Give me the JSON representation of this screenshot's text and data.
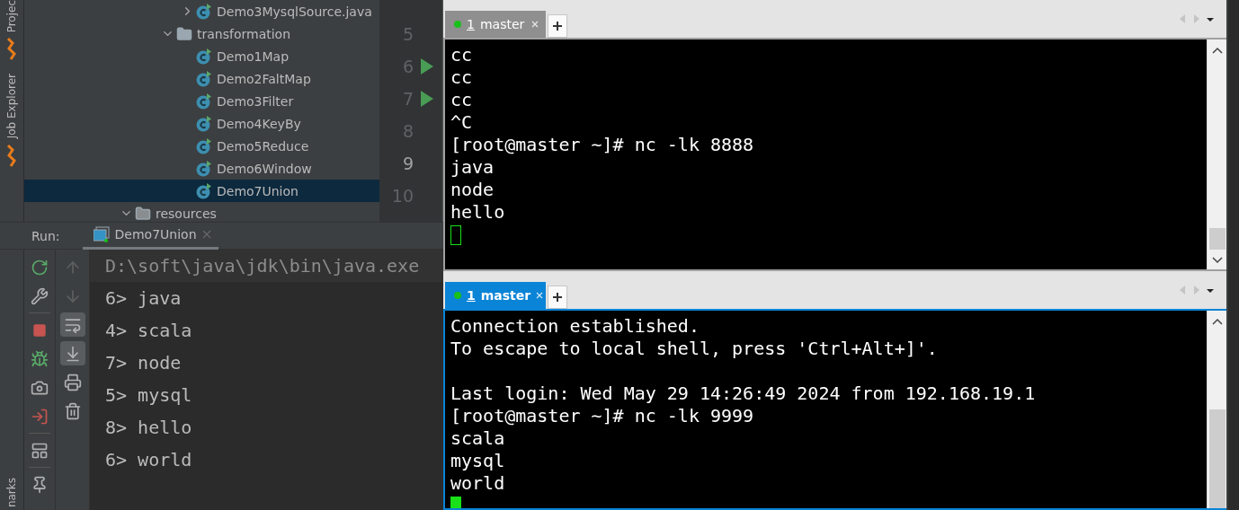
{
  "side_stripe": {
    "tabs": [
      {
        "label": "Projec",
        "kind": "top"
      },
      {
        "label": "Job Explorer",
        "kind": "top"
      },
      {
        "label": "narks",
        "kind": "bottom"
      }
    ]
  },
  "project_tree": {
    "items": [
      {
        "label": "Demo3MysqlSource.java",
        "kind": "class",
        "expanded": false,
        "selected": false
      },
      {
        "label": "transformation",
        "kind": "folder",
        "expanded": true,
        "selected": false,
        "children": [
          {
            "label": "Demo1Map",
            "kind": "class",
            "selected": false
          },
          {
            "label": "Demo2FaltMap",
            "kind": "class",
            "selected": false
          },
          {
            "label": "Demo3Filter",
            "kind": "class",
            "selected": false
          },
          {
            "label": "Demo4KeyBy",
            "kind": "class",
            "selected": false
          },
          {
            "label": "Demo5Reduce",
            "kind": "class",
            "selected": false
          },
          {
            "label": "Demo6Window",
            "kind": "class",
            "selected": false
          },
          {
            "label": "Demo7Union",
            "kind": "class",
            "selected": true
          }
        ]
      },
      {
        "label": "resources",
        "kind": "resources",
        "expanded": true,
        "selected": false
      }
    ]
  },
  "editor_gutter": {
    "lines": [
      {
        "number": "5",
        "runnable": false,
        "current": false
      },
      {
        "number": "6",
        "runnable": true,
        "current": false
      },
      {
        "number": "7",
        "runnable": true,
        "current": false
      },
      {
        "number": "8",
        "runnable": false,
        "current": false
      },
      {
        "number": "9",
        "runnable": false,
        "current": true
      },
      {
        "number": "10",
        "runnable": false,
        "current": false
      }
    ]
  },
  "run_panel": {
    "label": "Run:",
    "tab": {
      "label": "Demo7Union"
    },
    "toggles": [
      {
        "kind": "up",
        "on": false
      },
      {
        "kind": "down",
        "on": false
      },
      {
        "kind": "wrap",
        "on": true
      },
      {
        "kind": "scroll-end",
        "on": true
      },
      {
        "kind": "print",
        "on": false
      },
      {
        "kind": "trash",
        "on": false
      }
    ],
    "console": [
      {
        "text": "D:\\soft\\java\\jdk\\bin\\java.exe",
        "kind": "command"
      },
      {
        "text": "6> java",
        "kind": "output"
      },
      {
        "text": "4> scala",
        "kind": "output"
      },
      {
        "text": "7> node",
        "kind": "output"
      },
      {
        "text": "5> mysql",
        "kind": "output"
      },
      {
        "text": "8> hello",
        "kind": "output"
      },
      {
        "text": "6> world",
        "kind": "output"
      }
    ]
  },
  "terminals": [
    {
      "tab": {
        "number": "1",
        "label": "master",
        "active": false
      },
      "cursor_filled": false,
      "lines": [
        {
          "text": "cc"
        },
        {
          "text": "cc"
        },
        {
          "text": "cc"
        },
        {
          "text": "^C"
        },
        {
          "text": "[root@master ~]# nc -lk 8888"
        },
        {
          "text": "java"
        },
        {
          "text": "node"
        },
        {
          "text": "hello"
        }
      ]
    },
    {
      "tab": {
        "number": "1",
        "label": "master",
        "active": true
      },
      "cursor_filled": true,
      "lines": [
        {
          "text": "Connection established."
        },
        {
          "text": "To escape to local shell, press 'Ctrl+Alt+]'."
        },
        {
          "text": "Last login: Wed May 29 14:26:49 2024 from 192.168.19.1",
          "gap_before": true
        },
        {
          "text": "[root@master ~]# nc -lk 9999"
        },
        {
          "text": "scala"
        },
        {
          "text": "mysql"
        },
        {
          "text": "world"
        }
      ]
    }
  ]
}
